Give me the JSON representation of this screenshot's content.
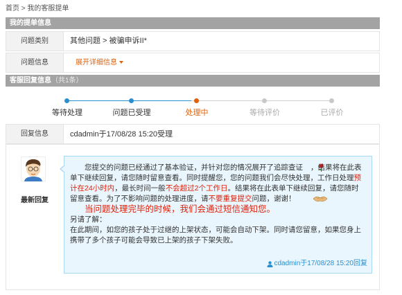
{
  "breadcrumb": {
    "home": "首页",
    "sep": ">",
    "current": "我的客服提单"
  },
  "ticket_section": {
    "title": "我的提单信息"
  },
  "ticket": {
    "category_label": "问题类别",
    "category_value": "其他问题 > 被骗申诉II*",
    "info_label": "问题信息",
    "expand_label": "展开详细信息"
  },
  "reply_section": {
    "title": "客服回复信息",
    "count": "（共1条）"
  },
  "progress": {
    "steps": [
      {
        "label": "等待处理",
        "state": "done"
      },
      {
        "label": "问题已受理",
        "state": "done"
      },
      {
        "label": "处理中",
        "state": "current"
      },
      {
        "label": "等待评价",
        "state": "todo"
      },
      {
        "label": "已评价",
        "state": "todo"
      }
    ],
    "colors": {
      "done": "#2a8fd0",
      "current": "#e0600a",
      "todo": "#aaaaaa"
    }
  },
  "reply_info": {
    "label": "回复信息",
    "value": "cdadmin于17/08/28 15:20受理"
  },
  "latest_reply": {
    "label": "最新回复",
    "p1_a": "您提交的问题已经通过了基本验证，并针对您的情况展开了追踪查证",
    "p1_b": "，结果将在此表单下继续回复，请您随时留意查看。同时提醒您，您的问题我们会尽快处理，工作日处理",
    "p1_red1": "预计在24小时内",
    "p1_c": "，最长时间一般",
    "p1_red2": "不会超过2个工作日",
    "p1_d": "。结果将在此表单下继续回复，请您随时留意查看。为了不影响问题的处理进度，请",
    "p1_red3": "不要重复提交",
    "p1_e": "问题，谢谢！",
    "p2": "当问题处理完毕的时候，我们会通过短信通知您。",
    "p3": "另请了解：",
    "p4": "在此期间，如您的孩子处于过继的上架状态，可能会自动下架。同时请您留意，如果您身上携带了多个孩子可能会导致已上架的孩子下架失败。",
    "signature": "cdadmin于17/08/28 15:20回复"
  }
}
